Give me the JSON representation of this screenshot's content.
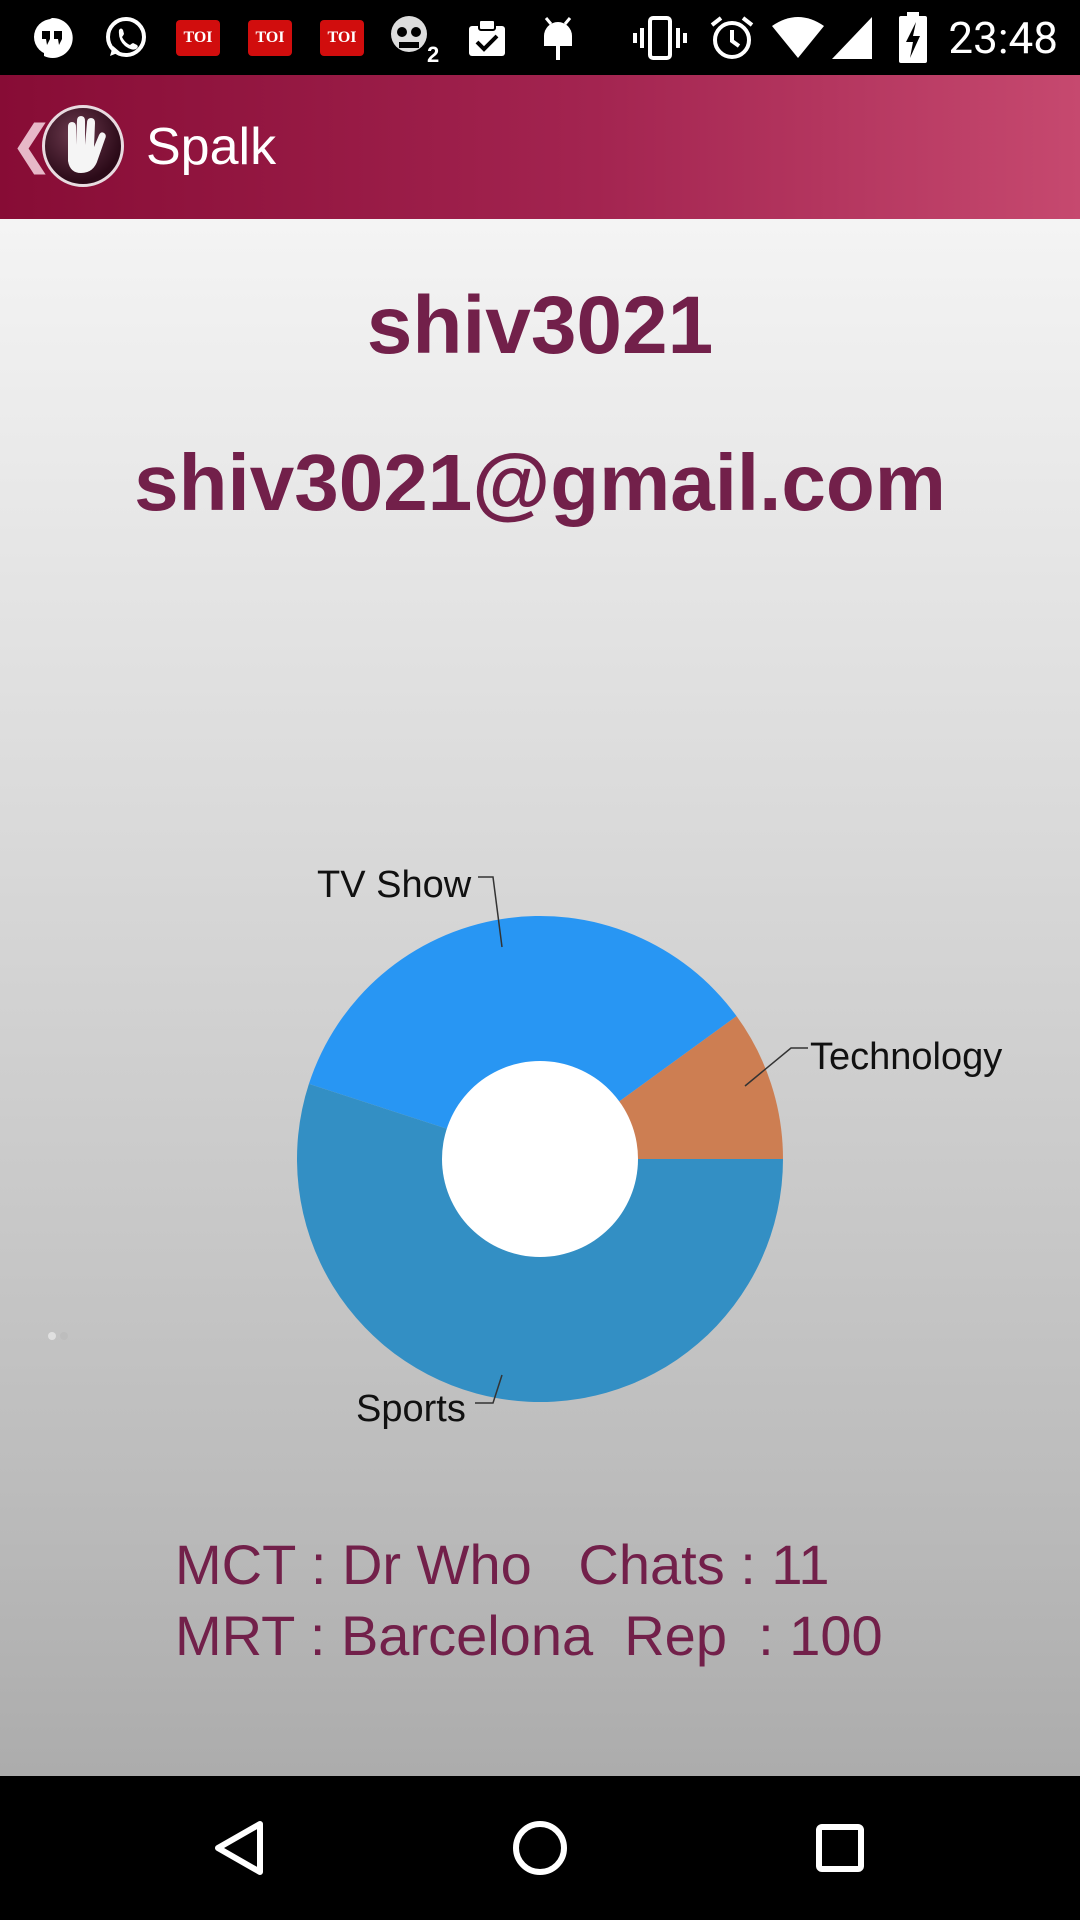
{
  "status_bar": {
    "time": "23:48",
    "toi_label": "TOI",
    "icons": [
      "hangouts-icon",
      "whatsapp-icon",
      "toi-icon",
      "toi-icon",
      "toi-icon",
      "zombie-game-icon",
      "clipboard-check-icon",
      "android-icon",
      "vibrate-icon",
      "alarm-icon",
      "wifi-icon",
      "signal-icon",
      "battery-charging-icon"
    ]
  },
  "app_bar": {
    "title": "Spalk",
    "back_icon": "chevron-left-icon",
    "logo_icon": "hand-icon"
  },
  "profile": {
    "username": "shiv3021",
    "email": "shiv3021@gmail.com"
  },
  "chart_data": {
    "type": "pie",
    "style": "donut",
    "categories": [
      "TV Show",
      "Technology",
      "Sports"
    ],
    "values": [
      35,
      10,
      55
    ],
    "colors": [
      "#2896f3",
      "#cd7e52",
      "#338fc4"
    ],
    "labels_shown": [
      "TV Show",
      "Technology",
      "Sports"
    ]
  },
  "stats": {
    "line1": "MCT : Dr Who   Chats : 11",
    "line2": "MRT : Barcelona  Rep  : 100"
  },
  "nav_bar": {
    "icons": [
      "back-triangle-icon",
      "home-circle-icon",
      "recents-square-icon"
    ]
  },
  "colors": {
    "accent": "#72204a",
    "app_bar_start": "#870c35",
    "app_bar_end": "#c6496f"
  }
}
